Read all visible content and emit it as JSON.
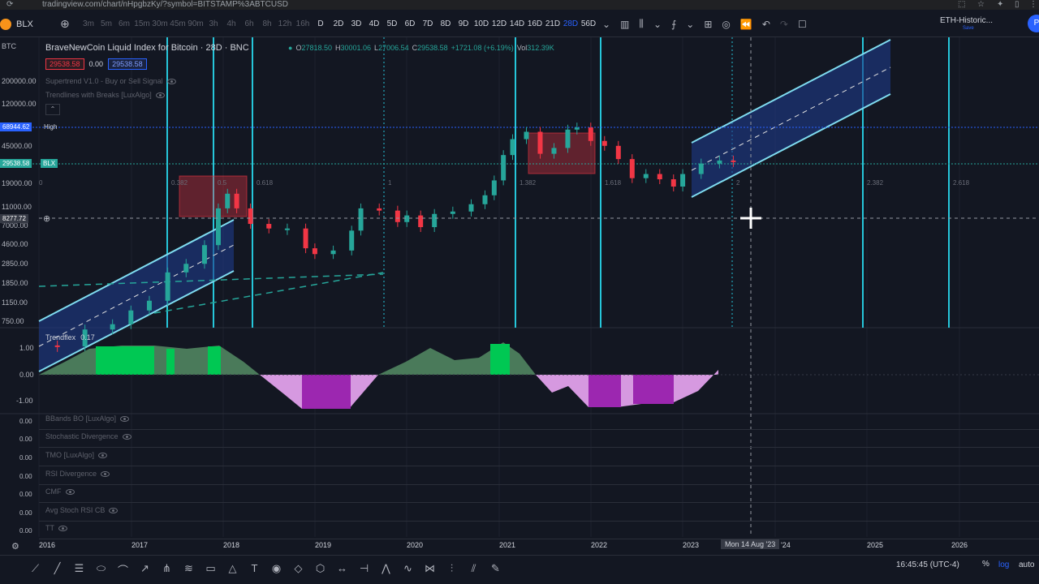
{
  "browser": {
    "url": "tradingview.com/chart/nHpgbzKy/?symbol=BITSTAMP%3ABTCUSD"
  },
  "toolbar": {
    "symbol": "BLX",
    "timeframes": [
      "3m",
      "5m",
      "6m",
      "15m",
      "30m",
      "45m",
      "90m",
      "3h",
      "4h",
      "6h",
      "8h",
      "12h",
      "16h",
      "D",
      "2D",
      "3D",
      "4D",
      "5D",
      "6D",
      "7D",
      "8D",
      "9D",
      "10D",
      "12D",
      "14D",
      "16D",
      "21D",
      "28D",
      "56D"
    ],
    "active_timeframe": "28D",
    "layout_name": "ETH-Historic...",
    "layout_status": "Save",
    "publish_label": "P"
  },
  "legend": {
    "title": "BraveNewCoin Liquid Index for Bitcoin · 28D · BNC",
    "open_label": "O",
    "open": "27818.50",
    "high_label": "H",
    "high": "30001.06",
    "low_label": "L",
    "low": "27006.54",
    "close_label": "C",
    "close": "29538.58",
    "change": "+1721.08 (+6.19%)",
    "vol_label": "Vol",
    "vol": "312.39K",
    "bid": "29538.58",
    "spread": "0.00",
    "ask": "29538.58"
  },
  "indicators": [
    "Supertrend V1.0 - Buy or Sell Signal",
    "Trendlines with Breaks [LuxAlgo]"
  ],
  "price_axis": {
    "currency": "BTC",
    "ticks": [
      "200000.00",
      "120000.00",
      "45000.00",
      "19000.00",
      "11000.00",
      "7000.00",
      "4600.00",
      "2850.00",
      "1850.00",
      "1150.00",
      "750.00"
    ],
    "high_value": "68944.62",
    "high_label": "High",
    "last_value": "29538.58",
    "last_label": "BLX",
    "cross_value": "8277.72"
  },
  "fib_labels": [
    "0",
    "0.382",
    "0.5",
    "0.618",
    "1",
    "1.382",
    "1.618",
    "2",
    "2.382",
    "2.618"
  ],
  "trendflex": {
    "name": "Trendflex",
    "value": "0.17",
    "ticks": [
      "1.00",
      "0.00",
      "-1.00"
    ]
  },
  "hidden_panes": [
    "BBands BO [LuxAlgo]",
    "Stochastic Divergence",
    "TMO [LuxAlgo]",
    "RSI Divergence",
    "CMF",
    "Avg Stoch RSI CB",
    "TT"
  ],
  "pane_zero": "0.00",
  "x_axis": {
    "years": [
      "2016",
      "2017",
      "2018",
      "2019",
      "2020",
      "2021",
      "2022",
      "2023",
      "'24",
      "2025",
      "2026"
    ],
    "crosshair_date": "Mon 14 Aug '23"
  },
  "status_bar": {
    "clock": "16:45:45 (UTC-4)",
    "percent": "%",
    "log": "log",
    "auto": "auto"
  },
  "colors": {
    "bg": "#131722",
    "up": "#26a69a",
    "down": "#f23645",
    "channel": "#1e3a8a",
    "vline": "#26c6da",
    "trend_green": "#00c853",
    "trend_purple": "#9c27b0"
  },
  "chart_data": {
    "type": "candlestick",
    "scale": "log",
    "timeframe": "28D",
    "candles_approx": [
      [
        2015.9,
        430
      ],
      [
        2016.2,
        420
      ],
      [
        2016.5,
        620
      ],
      [
        2016.8,
        700
      ],
      [
        2017.0,
        960
      ],
      [
        2017.2,
        1200
      ],
      [
        2017.4,
        2300
      ],
      [
        2017.6,
        2800
      ],
      [
        2017.8,
        4300
      ],
      [
        2017.95,
        10000
      ],
      [
        2018.05,
        14000
      ],
      [
        2018.15,
        10000
      ],
      [
        2018.3,
        7000
      ],
      [
        2018.5,
        6300
      ],
      [
        2018.7,
        6300
      ],
      [
        2018.9,
        4000
      ],
      [
        2019.0,
        3500
      ],
      [
        2019.2,
        3800
      ],
      [
        2019.4,
        6000
      ],
      [
        2019.5,
        10000
      ],
      [
        2019.7,
        9500
      ],
      [
        2019.9,
        7300
      ],
      [
        2020.0,
        8500
      ],
      [
        2020.15,
        6500
      ],
      [
        2020.3,
        8800
      ],
      [
        2020.5,
        9300
      ],
      [
        2020.7,
        11000
      ],
      [
        2020.85,
        13500
      ],
      [
        2020.95,
        19000
      ],
      [
        2021.05,
        34000
      ],
      [
        2021.15,
        49000
      ],
      [
        2021.3,
        58000
      ],
      [
        2021.45,
        35000
      ],
      [
        2021.6,
        40000
      ],
      [
        2021.75,
        61000
      ],
      [
        2021.85,
        64000
      ],
      [
        2022.0,
        47000
      ],
      [
        2022.15,
        42000
      ],
      [
        2022.3,
        31000
      ],
      [
        2022.45,
        20000
      ],
      [
        2022.6,
        22000
      ],
      [
        2022.75,
        19500
      ],
      [
        2022.9,
        16500
      ],
      [
        2023.0,
        22000
      ],
      [
        2023.2,
        28000
      ],
      [
        2023.4,
        30000
      ],
      [
        2023.55,
        29538
      ]
    ]
  }
}
